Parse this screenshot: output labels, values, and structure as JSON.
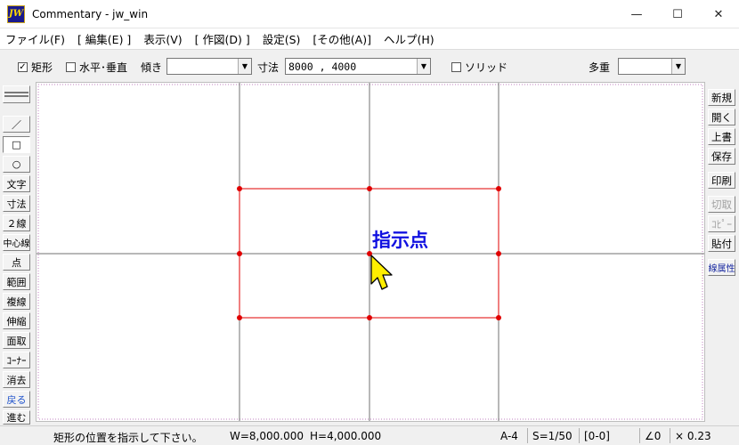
{
  "window": {
    "title": "Commentary - jw_win",
    "icon_text": "JW"
  },
  "window_controls": {
    "minimize": "—",
    "maximize": "☐",
    "close": "✕"
  },
  "menu": [
    "ファイル(F)",
    "[ 編集(E) ]",
    "表示(V)",
    "[ 作図(D) ]",
    "設定(S)",
    "[その他(A)]",
    "ヘルプ(H)"
  ],
  "toolbar": {
    "rect_check": "✓",
    "rect_label": "矩形",
    "hv_label": "水平･垂直",
    "tilt_label": "傾き",
    "tilt_value": "",
    "dim_label": "寸法",
    "dim_value": "8000 , 4000",
    "solid_label": "ソリッド",
    "multi_label": "多重",
    "multi_value": ""
  },
  "left_tools": [
    "／",
    "□",
    "○",
    "文字",
    "寸法",
    "２線",
    "中心線",
    "点",
    "範囲",
    "複線",
    "伸縮",
    "面取",
    "ｺｰﾅｰ",
    "消去",
    "戻る",
    "進む"
  ],
  "right_tools": [
    "新規",
    "開く",
    "上書",
    "保存",
    "印刷",
    "切取",
    "ｺﾋﾟｰ",
    "貼付",
    "線属性"
  ],
  "canvas": {
    "annotation": "指示点"
  },
  "status": {
    "message": "矩形の位置を指示して下さい。",
    "width": "W=8,000.000",
    "height": "H=4,000.000",
    "paper": "A-4",
    "scale": "S=1/50",
    "layer": "[0-0]",
    "angle": "∠0",
    "zoom": "× 0.23"
  },
  "colors": {
    "rect": "#e00000",
    "annotation": "#1010e0",
    "guide": "#707070",
    "cursor": "#ffee00"
  }
}
